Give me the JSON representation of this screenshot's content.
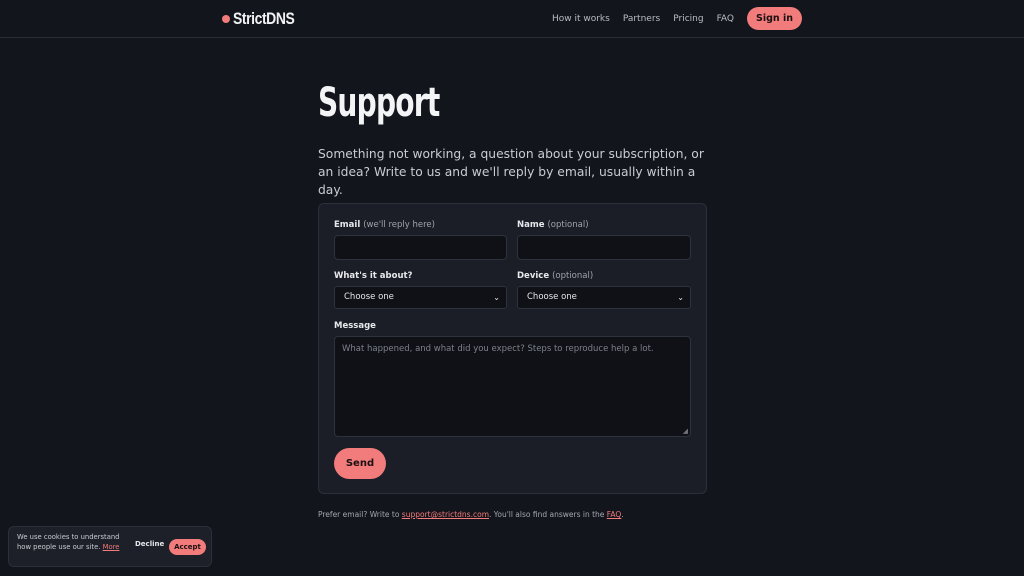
{
  "header": {
    "brand": "StrictDNS",
    "nav": [
      "How it works",
      "Partners",
      "Pricing",
      "FAQ"
    ],
    "signin_label": "Sign in"
  },
  "page": {
    "title": "Support",
    "lead": "Something not working, a question about your subscription, or an idea? Write to us and we'll reply by email, usually within a day."
  },
  "form": {
    "email_label": "Email",
    "email_hint": "(we'll reply here)",
    "email_value": "",
    "name_label": "Name",
    "name_hint": "(optional)",
    "name_value": "",
    "topic_label": "What's it about?",
    "topic_value": "Choose one",
    "device_label": "Device",
    "device_hint": "(optional)",
    "device_value": "Choose one",
    "message_label": "Message",
    "message_placeholder": "What happened, and what did you expect? Steps to reproduce help a lot.",
    "send_label": "Send"
  },
  "footnote": {
    "prefix": "Prefer email? Write to ",
    "email": "support@strictdns.com",
    "middle": ". You'll also find answers in the ",
    "faq": "FAQ",
    "suffix": "."
  },
  "cookie": {
    "text": "We use cookies to understand how people use our site.",
    "more": "More",
    "decline": "Decline",
    "accept": "Accept"
  },
  "colors": {
    "accent": "#f27b7b",
    "background": "#13151c",
    "card": "#1b1e26"
  }
}
